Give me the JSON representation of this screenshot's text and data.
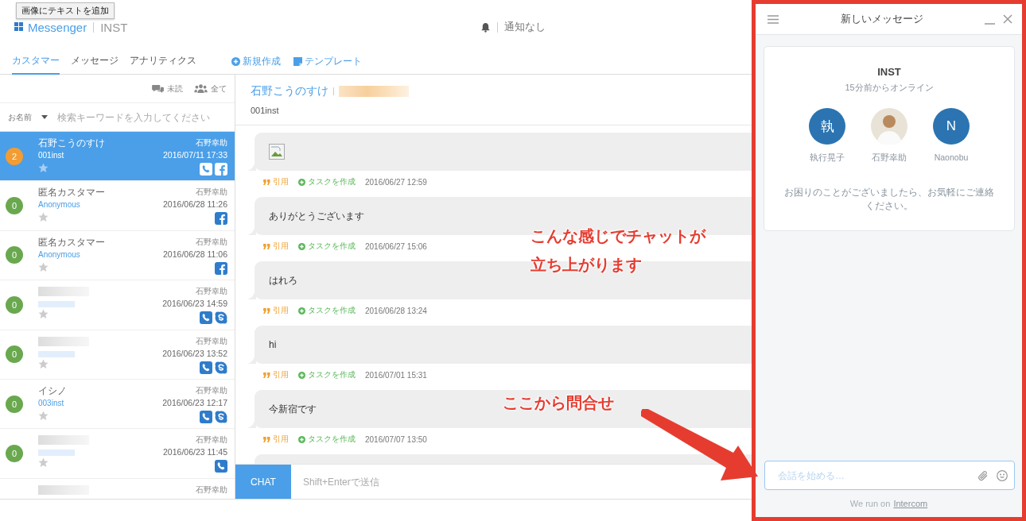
{
  "tooltip": "画像にテキストを追加",
  "header": {
    "brand": "Messenger",
    "account": "INST",
    "notification": "通知なし"
  },
  "tabs": [
    {
      "label": "カスタマー",
      "selected": true
    },
    {
      "label": "メッセージ",
      "selected": false
    },
    {
      "label": "アナリティクス",
      "selected": false
    }
  ],
  "actions": [
    {
      "kind": "new",
      "label": "新規作成"
    },
    {
      "kind": "template",
      "label": "テンプレート"
    }
  ],
  "list_toolbar": {
    "unread": "未読",
    "all": "全て"
  },
  "filter": {
    "field": "お名前",
    "placeholder": "検索キーワードを入力してください"
  },
  "customers": [
    {
      "count": "2",
      "color": "#f39c33",
      "name": "石野こうのすけ",
      "handle": "001inst",
      "assignee": "石野幸助",
      "time": "2016/07/11 17:33",
      "selected": true,
      "channels": [
        {
          "kind": "phone"
        },
        {
          "kind": "facebook"
        }
      ]
    },
    {
      "count": "0",
      "color": "#6aa84f",
      "name": "匿名カスタマー",
      "handle": "Anonymous",
      "assignee": "石野幸助",
      "time": "2016/06/28 11:26",
      "selected": false,
      "channels": [
        {
          "kind": "facebook"
        }
      ]
    },
    {
      "count": "0",
      "color": "#6aa84f",
      "name": "匿名カスタマー",
      "handle": "Anonymous",
      "assignee": "石野幸助",
      "time": "2016/06/28 11:06",
      "selected": false,
      "channels": [
        {
          "kind": "facebook"
        }
      ]
    },
    {
      "count": "0",
      "color": "#6aa84f",
      "assignee": "石野幸助",
      "time": "2016/06/23 14:59",
      "selected": false,
      "channels": [
        {
          "kind": "phone"
        },
        {
          "kind": "skype"
        }
      ]
    },
    {
      "count": "0",
      "color": "#6aa84f",
      "assignee": "石野幸助",
      "time": "2016/06/23 13:52",
      "selected": false,
      "channels": [
        {
          "kind": "phone"
        },
        {
          "kind": "skype"
        }
      ]
    },
    {
      "count": "0",
      "color": "#6aa84f",
      "name": "イシノ",
      "handle": "003inst",
      "assignee": "石野幸助",
      "time": "2016/06/23 12:17",
      "selected": false,
      "channels": [
        {
          "kind": "phone"
        },
        {
          "kind": "skype"
        }
      ]
    },
    {
      "count": "0",
      "color": "#6aa84f",
      "assignee": "石野幸助",
      "time": "2016/06/23 11:45",
      "selected": false,
      "channels": [
        {
          "kind": "phone"
        }
      ]
    },
    {
      "assignee": "石野幸助",
      "selected": false
    }
  ],
  "conversation": {
    "name": "石野こうのすけ",
    "handle": "001inst",
    "messages": [
      {
        "kind": "image",
        "quote": "引用",
        "task": "タスクを作成",
        "time": "2016/06/27 12:59"
      },
      {
        "kind": "text",
        "text": "ありがとうございます",
        "quote": "引用",
        "task": "タスクを作成",
        "time": "2016/06/27 15:06"
      },
      {
        "kind": "text",
        "text": "はれろ",
        "quote": "引用",
        "task": "タスクを作成",
        "time": "2016/06/28 13:24"
      },
      {
        "kind": "text",
        "text": "hi",
        "quote": "引用",
        "task": "タスクを作成",
        "time": "2016/07/01 15:31"
      },
      {
        "kind": "text",
        "text": "今新宿です",
        "quote": "引用",
        "task": "タスクを作成",
        "time": "2016/07/07 13:50"
      },
      {
        "kind": "text"
      }
    ],
    "composer": {
      "button": "CHAT",
      "placeholder": "Shift+Enterで送信"
    }
  },
  "widget": {
    "title": "新しいメッセージ",
    "team": "INST",
    "status": "15分前からオンライン",
    "agents": [
      {
        "kind": "initial",
        "initial": "執",
        "name": "執行晃子"
      },
      {
        "kind": "photo",
        "name": "石野幸助"
      },
      {
        "kind": "initial",
        "initial": "N",
        "name": "Naonobu"
      }
    ],
    "greeting": "お困りのことがございましたら、お気軽にご連絡ください。",
    "input_placeholder": "会話を始める…",
    "footer": "We run on",
    "footer_link": "Intercom"
  },
  "annotations": [
    {
      "kind": "callout",
      "lines": [
        "こんな感じでチャットが",
        "立ち上がります"
      ]
    },
    {
      "kind": "arrow",
      "lines": [
        "ここから問合せ"
      ]
    }
  ]
}
